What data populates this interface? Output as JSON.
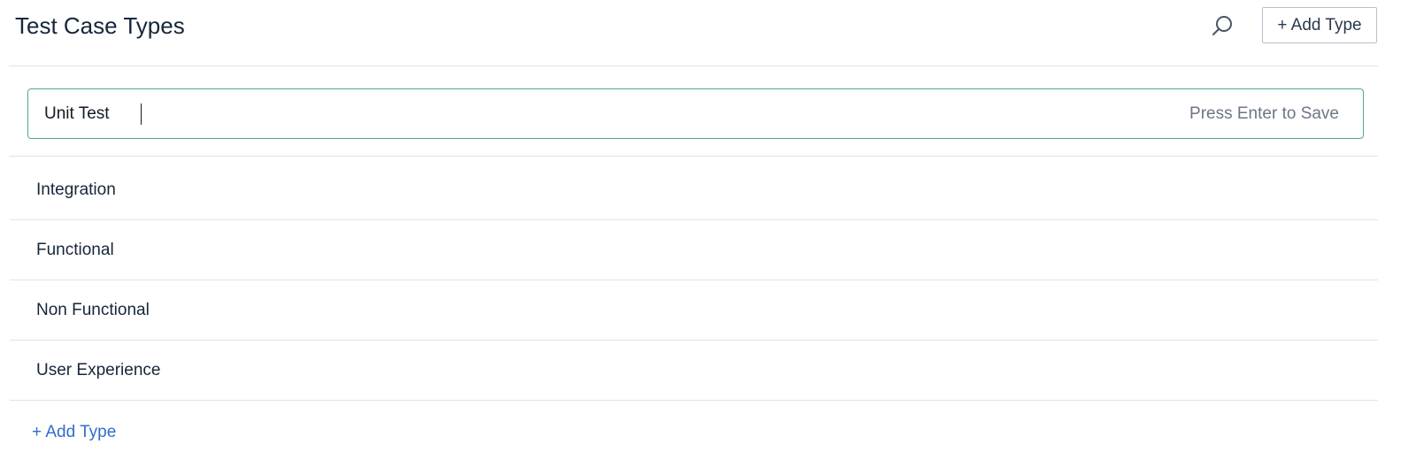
{
  "header": {
    "title": "Test Case Types",
    "search_icon": "search-icon",
    "add_button_label": "+ Add Type"
  },
  "editor": {
    "value": "Unit Test",
    "hint": "Press Enter to Save",
    "border_color": "#4caf7a"
  },
  "types": {
    "items": [
      {
        "label": "Integration"
      },
      {
        "label": "Functional"
      },
      {
        "label": "Non Functional"
      },
      {
        "label": "User Experience"
      }
    ]
  },
  "footer": {
    "add_link_label": "+ Add Type",
    "link_color": "#2f6fca"
  }
}
